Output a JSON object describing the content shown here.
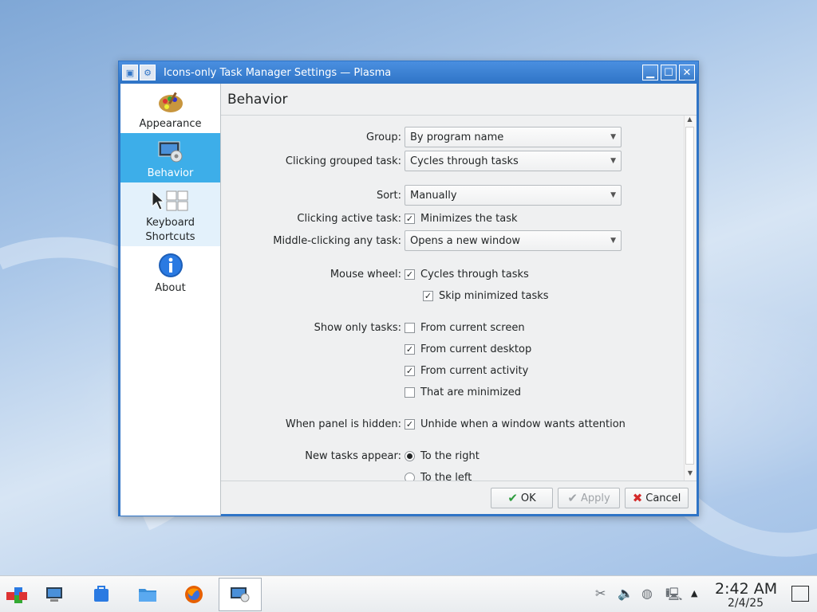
{
  "window": {
    "title": "Icons-only Task Manager Settings — Plasma",
    "minimize_icon": "minimize-icon",
    "maximize_icon": "maximize-icon",
    "close_icon": "close-icon"
  },
  "sidebar": {
    "items": [
      {
        "label": "Appearance",
        "icon": "palette-icon"
      },
      {
        "label": "Behavior",
        "icon": "settings-monitor-icon"
      },
      {
        "label": "Keyboard\nShortcuts",
        "icon": "keyboard-icon"
      },
      {
        "label": "About",
        "icon": "info-icon"
      }
    ]
  },
  "page": {
    "title": "Behavior"
  },
  "form": {
    "group_label": "Group:",
    "group_value": "By program name",
    "clicking_grouped_label": "Clicking grouped task:",
    "clicking_grouped_value": "Cycles through tasks",
    "sort_label": "Sort:",
    "sort_value": "Manually",
    "clicking_active_label": "Clicking active task:",
    "clicking_active_option": "Minimizes the task",
    "middle_click_label": "Middle-clicking any task:",
    "middle_click_value": "Opens a new window",
    "mouse_wheel_label": "Mouse wheel:",
    "mouse_wheel_option": "Cycles through tasks",
    "skip_minimized_option": "Skip minimized tasks",
    "show_only_label": "Show only tasks:",
    "show_only_screen": "From current screen",
    "show_only_desktop": "From current desktop",
    "show_only_activity": "From current activity",
    "show_only_minimized": "That are minimized",
    "panel_hidden_label": "When panel is hidden:",
    "panel_hidden_option": "Unhide when a window wants attention",
    "new_tasks_label": "New tasks appear:",
    "new_tasks_right": "To the right",
    "new_tasks_left": "To the left"
  },
  "buttons": {
    "ok": "OK",
    "apply": "Apply",
    "cancel": "Cancel"
  },
  "taskbar": {
    "clock_time": "2:42 AM",
    "clock_date": "2/4/25"
  }
}
